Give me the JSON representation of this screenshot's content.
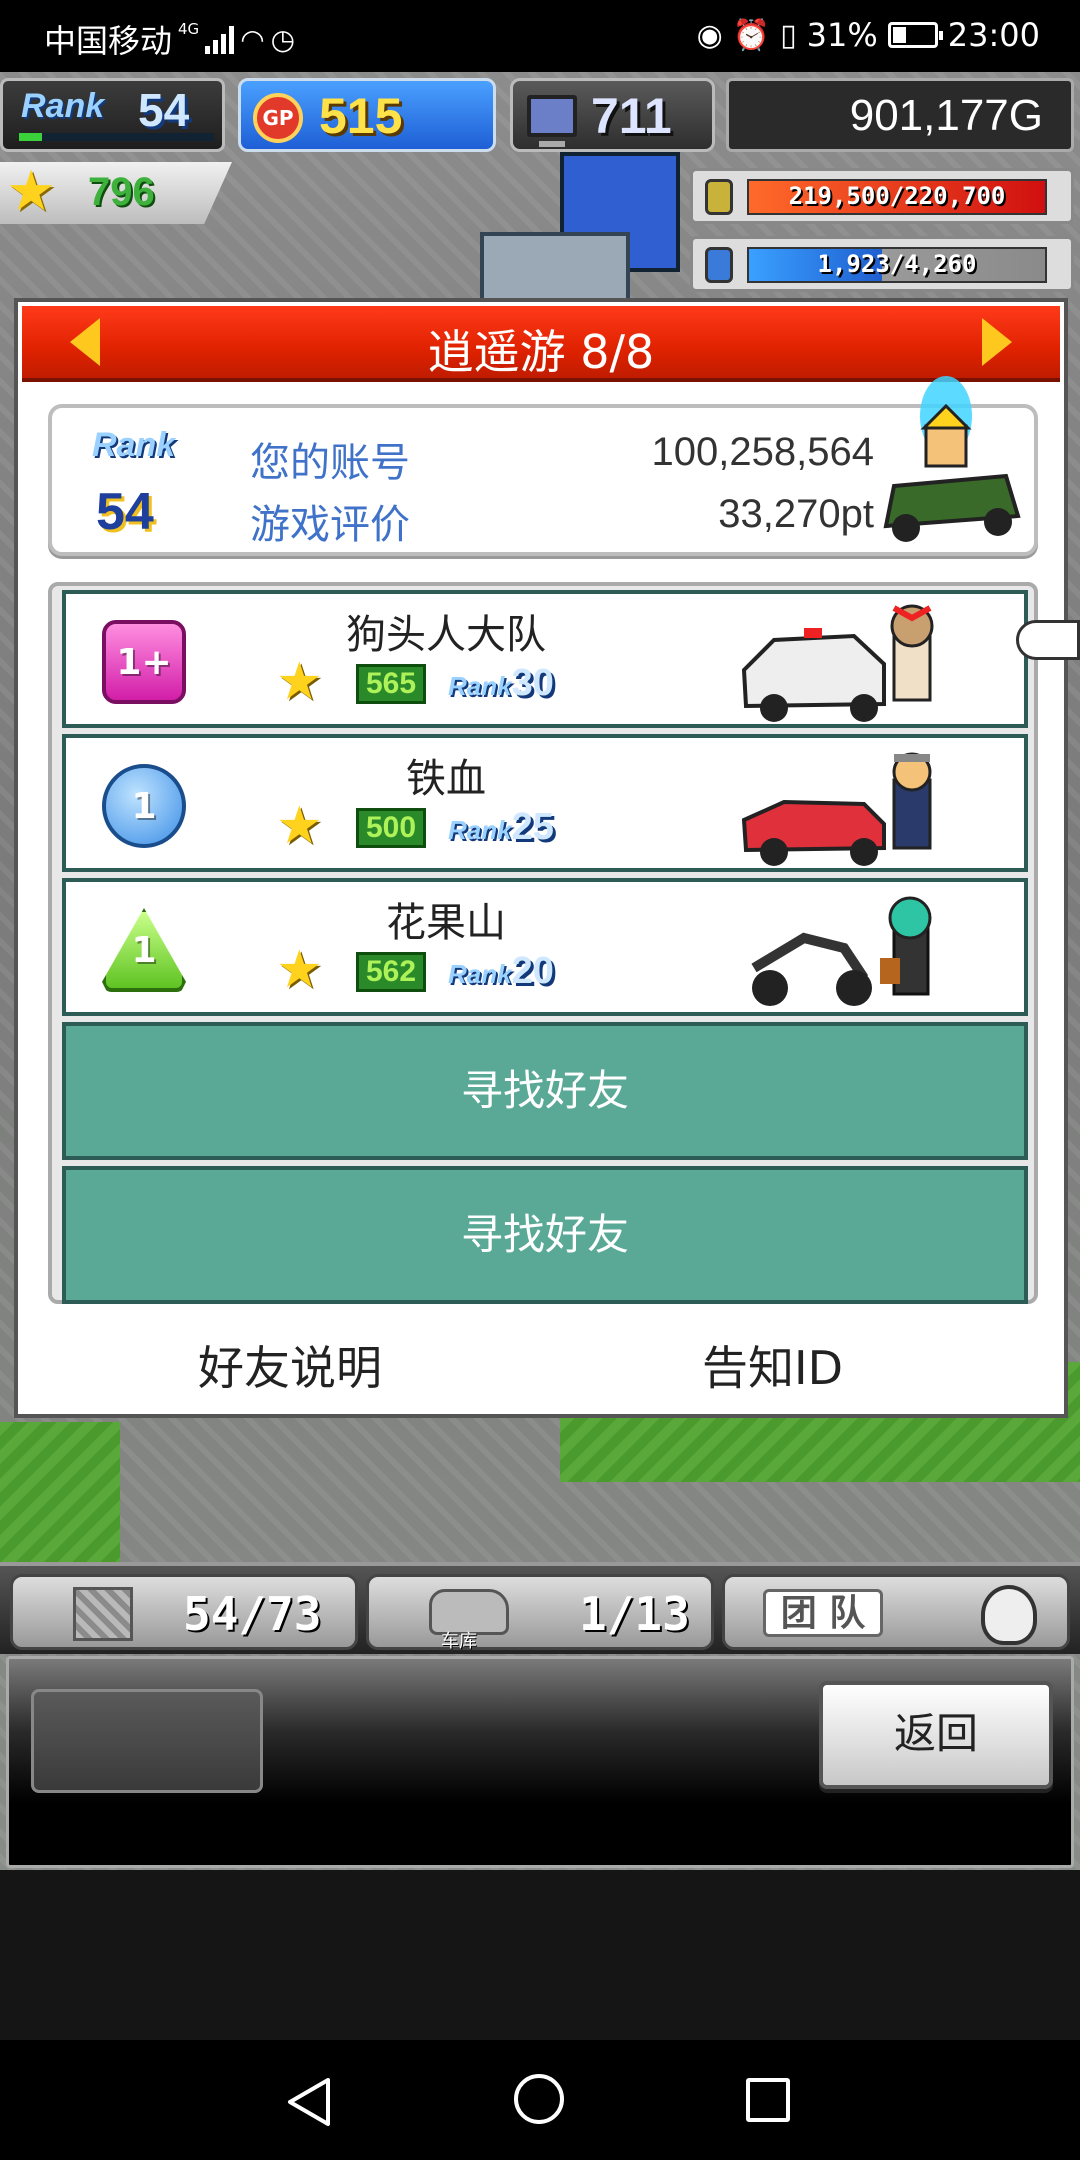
{
  "status_bar": {
    "carrier": "中国移动",
    "network": "4G",
    "battery": "31%",
    "time": "23:00"
  },
  "hud": {
    "rank_label": "Rank",
    "rank": "54",
    "gp": "515",
    "gp_icon_label": "GP",
    "pc_count": "711",
    "money": "901,177G",
    "stars": "796",
    "resource_gold": "219,500/220,700",
    "resource_gold_fill": 0.99,
    "resource_water": "1,923/4,260",
    "resource_water_fill": 0.45
  },
  "dialog": {
    "title": "逍遥游 8/8",
    "account": {
      "rank_label": "Rank",
      "rank": "54",
      "account_label": "您的账号",
      "account_value": "100,258,564",
      "rating_label": "游戏评价",
      "rating_value": "33,270pt"
    },
    "friends": [
      {
        "badge": "1+",
        "badge_style": "pink",
        "name": "狗头人大队",
        "gp": "565",
        "rank_label": "Rank",
        "rank": "30"
      },
      {
        "badge": "1",
        "badge_style": "blue",
        "name": "铁血",
        "gp": "500",
        "rank_label": "Rank",
        "rank": "25"
      },
      {
        "badge": "1",
        "badge_style": "green",
        "name": "花果山",
        "gp": "562",
        "rank_label": "Rank",
        "rank": "20"
      }
    ],
    "find_friend_1": "寻找好友",
    "find_friend_2": "寻找好友",
    "friend_help": "好友说明",
    "notify_id": "告知ID"
  },
  "lower_hud": {
    "tab1_value": "54/73",
    "tab2_label": "车库",
    "tab2_value": "1/13",
    "tab3_label": "团 队"
  },
  "controls": {
    "back": "返回"
  }
}
